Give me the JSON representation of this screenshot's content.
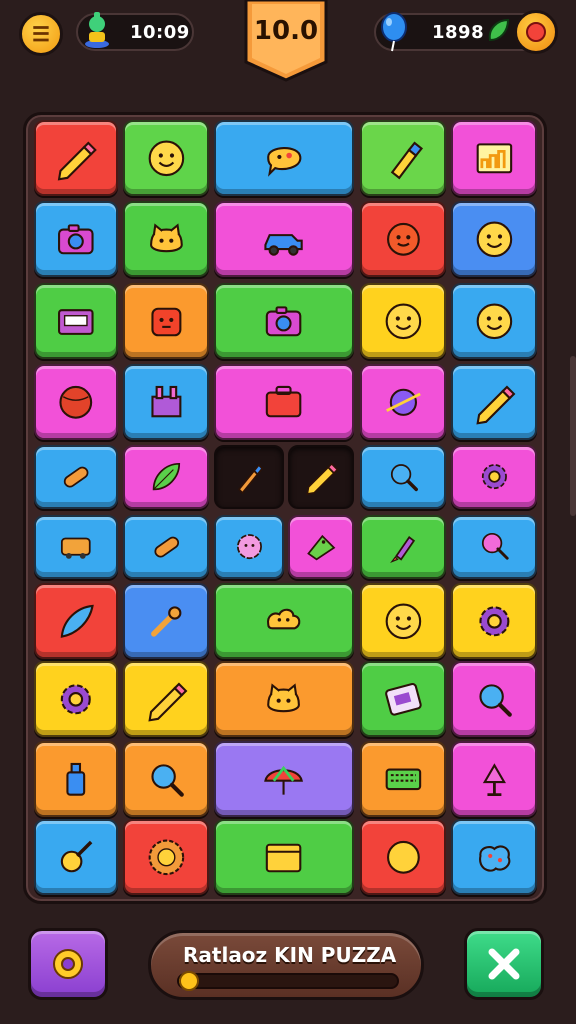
{
  "header": {
    "menu_icon": "menu-icon",
    "timer": "10:09",
    "level": "10.0",
    "score": "1898"
  },
  "colors": {
    "red": "#f2433a",
    "green": "#48d04a",
    "blue": "#34a8f2",
    "pink": "#f14ed8",
    "orange": "#fb9a2e",
    "yellow": "#ffd21e",
    "purple": "#9a78f2",
    "lime": "#7ee04a"
  },
  "board": {
    "tiles": [
      {
        "row": 0,
        "col": 0,
        "span": 1,
        "color": "#f2433a",
        "icon": "pencil-icon"
      },
      {
        "row": 0,
        "col": 1,
        "span": 1,
        "color": "#5fd44a",
        "icon": "smiley-face-icon"
      },
      {
        "row": 0,
        "col": 2,
        "span": 2,
        "color": "#39a9f0",
        "icon": "speech-blob-icon"
      },
      {
        "row": 0,
        "col": 4,
        "span": 1,
        "color": "#6ad64a",
        "icon": "marker-icon"
      },
      {
        "row": 0,
        "col": 5,
        "span": 1,
        "color": "#f251d8",
        "icon": "chart-icon"
      },
      {
        "row": 1,
        "col": 0,
        "span": 1,
        "color": "#39a9f0",
        "icon": "camera-icon"
      },
      {
        "row": 1,
        "col": 1,
        "span": 1,
        "color": "#4fcd45",
        "icon": "cat-face-icon"
      },
      {
        "row": 1,
        "col": 2,
        "span": 2,
        "color": "#f251d8",
        "icon": "car-icon"
      },
      {
        "row": 1,
        "col": 4,
        "span": 1,
        "color": "#f2433a",
        "icon": "sun-face-icon"
      },
      {
        "row": 1,
        "col": 5,
        "span": 1,
        "color": "#4a8ef2",
        "icon": "smiley-face-icon"
      },
      {
        "row": 2,
        "col": 0,
        "span": 1,
        "color": "#4fcd45",
        "icon": "radio-icon"
      },
      {
        "row": 2,
        "col": 1,
        "span": 1,
        "color": "#fb9a2e",
        "icon": "robot-face-icon"
      },
      {
        "row": 2,
        "col": 2,
        "span": 2,
        "color": "#4fcd45",
        "icon": "camera-icon"
      },
      {
        "row": 2,
        "col": 4,
        "span": 1,
        "color": "#ffd21e",
        "icon": "smiley-face-icon"
      },
      {
        "row": 2,
        "col": 5,
        "span": 1,
        "color": "#39a9f0",
        "icon": "smiley-face-icon"
      },
      {
        "row": 3,
        "col": 0,
        "span": 1,
        "color": "#f251d8",
        "icon": "ball-icon"
      },
      {
        "row": 3,
        "col": 1,
        "span": 1,
        "color": "#39a9f0",
        "icon": "castle-icon"
      },
      {
        "row": 3,
        "col": 2,
        "span": 2,
        "color": "#f251d8",
        "icon": "toolbox-icon"
      },
      {
        "row": 3,
        "col": 4,
        "span": 1,
        "color": "#f251d8",
        "icon": "planet-icon"
      },
      {
        "row": 3,
        "col": 5,
        "span": 1,
        "color": "#39a9f0",
        "icon": "pencil-icon"
      },
      {
        "row": 4,
        "col": 0,
        "span": 1,
        "color": "#39a9f0",
        "icon": "capsule-icon"
      },
      {
        "row": 4,
        "col": 1,
        "span": 1,
        "color": "#f251d8",
        "icon": "leaf-icon"
      },
      {
        "row": 4,
        "col": 2,
        "span": 1,
        "color": "#1e1212",
        "icon": "brush-icon",
        "empty": true
      },
      {
        "row": 4,
        "col": 3,
        "span": 1,
        "color": "#1e1212",
        "icon": "pencil-icon",
        "empty": true
      },
      {
        "row": 4,
        "col": 4,
        "span": 1,
        "color": "#39a9f0",
        "icon": "magnifier-icon"
      },
      {
        "row": 4,
        "col": 5,
        "span": 1,
        "color": "#f251d8",
        "icon": "gear-icon"
      },
      {
        "row": 5,
        "col": 0,
        "span": 1,
        "color": "#39a9f0",
        "icon": "bus-icon"
      },
      {
        "row": 5,
        "col": 1,
        "span": 1,
        "color": "#39a9f0",
        "icon": "capsule-icon"
      },
      {
        "row": 5,
        "col": 2,
        "span": 1,
        "color": "#39a9f0",
        "icon": "flower-icon"
      },
      {
        "row": 5,
        "col": 3,
        "span": 1,
        "color": "#f251d8",
        "icon": "tag-icon"
      },
      {
        "row": 5,
        "col": 4,
        "span": 1,
        "color": "#4fcd45",
        "icon": "rocket-icon"
      },
      {
        "row": 5,
        "col": 5,
        "span": 1,
        "color": "#39a9f0",
        "icon": "lollipop-icon"
      },
      {
        "row": 6,
        "col": 0,
        "span": 1,
        "color": "#f2433a",
        "icon": "feather-icon"
      },
      {
        "row": 6,
        "col": 1,
        "span": 1,
        "color": "#4a8ef2",
        "icon": "wrench-icon"
      },
      {
        "row": 6,
        "col": 2,
        "span": 2,
        "color": "#4fcd45",
        "icon": "cloud-face-icon"
      },
      {
        "row": 6,
        "col": 4,
        "span": 1,
        "color": "#ffd21e",
        "icon": "smiley-face-icon"
      },
      {
        "row": 6,
        "col": 5,
        "span": 1,
        "color": "#ffd21e",
        "icon": "gear-icon"
      },
      {
        "row": 7,
        "col": 0,
        "span": 1,
        "color": "#ffd21e",
        "icon": "gear-icon"
      },
      {
        "row": 7,
        "col": 1,
        "span": 1,
        "color": "#ffd21e",
        "icon": "pencil-icon"
      },
      {
        "row": 7,
        "col": 2,
        "span": 2,
        "color": "#fb9a2e",
        "icon": "cat-face-icon"
      },
      {
        "row": 7,
        "col": 4,
        "span": 1,
        "color": "#4fcd45",
        "icon": "ticket-icon"
      },
      {
        "row": 7,
        "col": 5,
        "span": 1,
        "color": "#f251d8",
        "icon": "magnifier-icon"
      },
      {
        "row": 8,
        "col": 0,
        "span": 1,
        "color": "#fb9a2e",
        "icon": "bottle-icon"
      },
      {
        "row": 8,
        "col": 1,
        "span": 1,
        "color": "#fb9a2e",
        "icon": "magnifier-icon"
      },
      {
        "row": 8,
        "col": 2,
        "span": 2,
        "color": "#9a78f2",
        "icon": "umbrella-icon"
      },
      {
        "row": 8,
        "col": 4,
        "span": 1,
        "color": "#fb9a2e",
        "icon": "keyboard-icon"
      },
      {
        "row": 8,
        "col": 5,
        "span": 1,
        "color": "#f251d8",
        "icon": "lamp-icon"
      },
      {
        "row": 9,
        "col": 0,
        "span": 1,
        "color": "#39a9f0",
        "icon": "guitar-icon"
      },
      {
        "row": 9,
        "col": 1,
        "span": 1,
        "color": "#f2433a",
        "icon": "sun-icon"
      },
      {
        "row": 9,
        "col": 2,
        "span": 2,
        "color": "#4fcd45",
        "icon": "folder-icon"
      },
      {
        "row": 9,
        "col": 4,
        "span": 1,
        "color": "#f2433a",
        "icon": "circle-icon"
      },
      {
        "row": 9,
        "col": 5,
        "span": 1,
        "color": "#39a9f0",
        "icon": "puzzle-blob-icon"
      }
    ]
  },
  "footer": {
    "settings_icon": "gear-icon",
    "progress_title": "Ratlaoz KIN PUZZA",
    "progress_value": 0.05,
    "close_icon": "close-icon"
  }
}
